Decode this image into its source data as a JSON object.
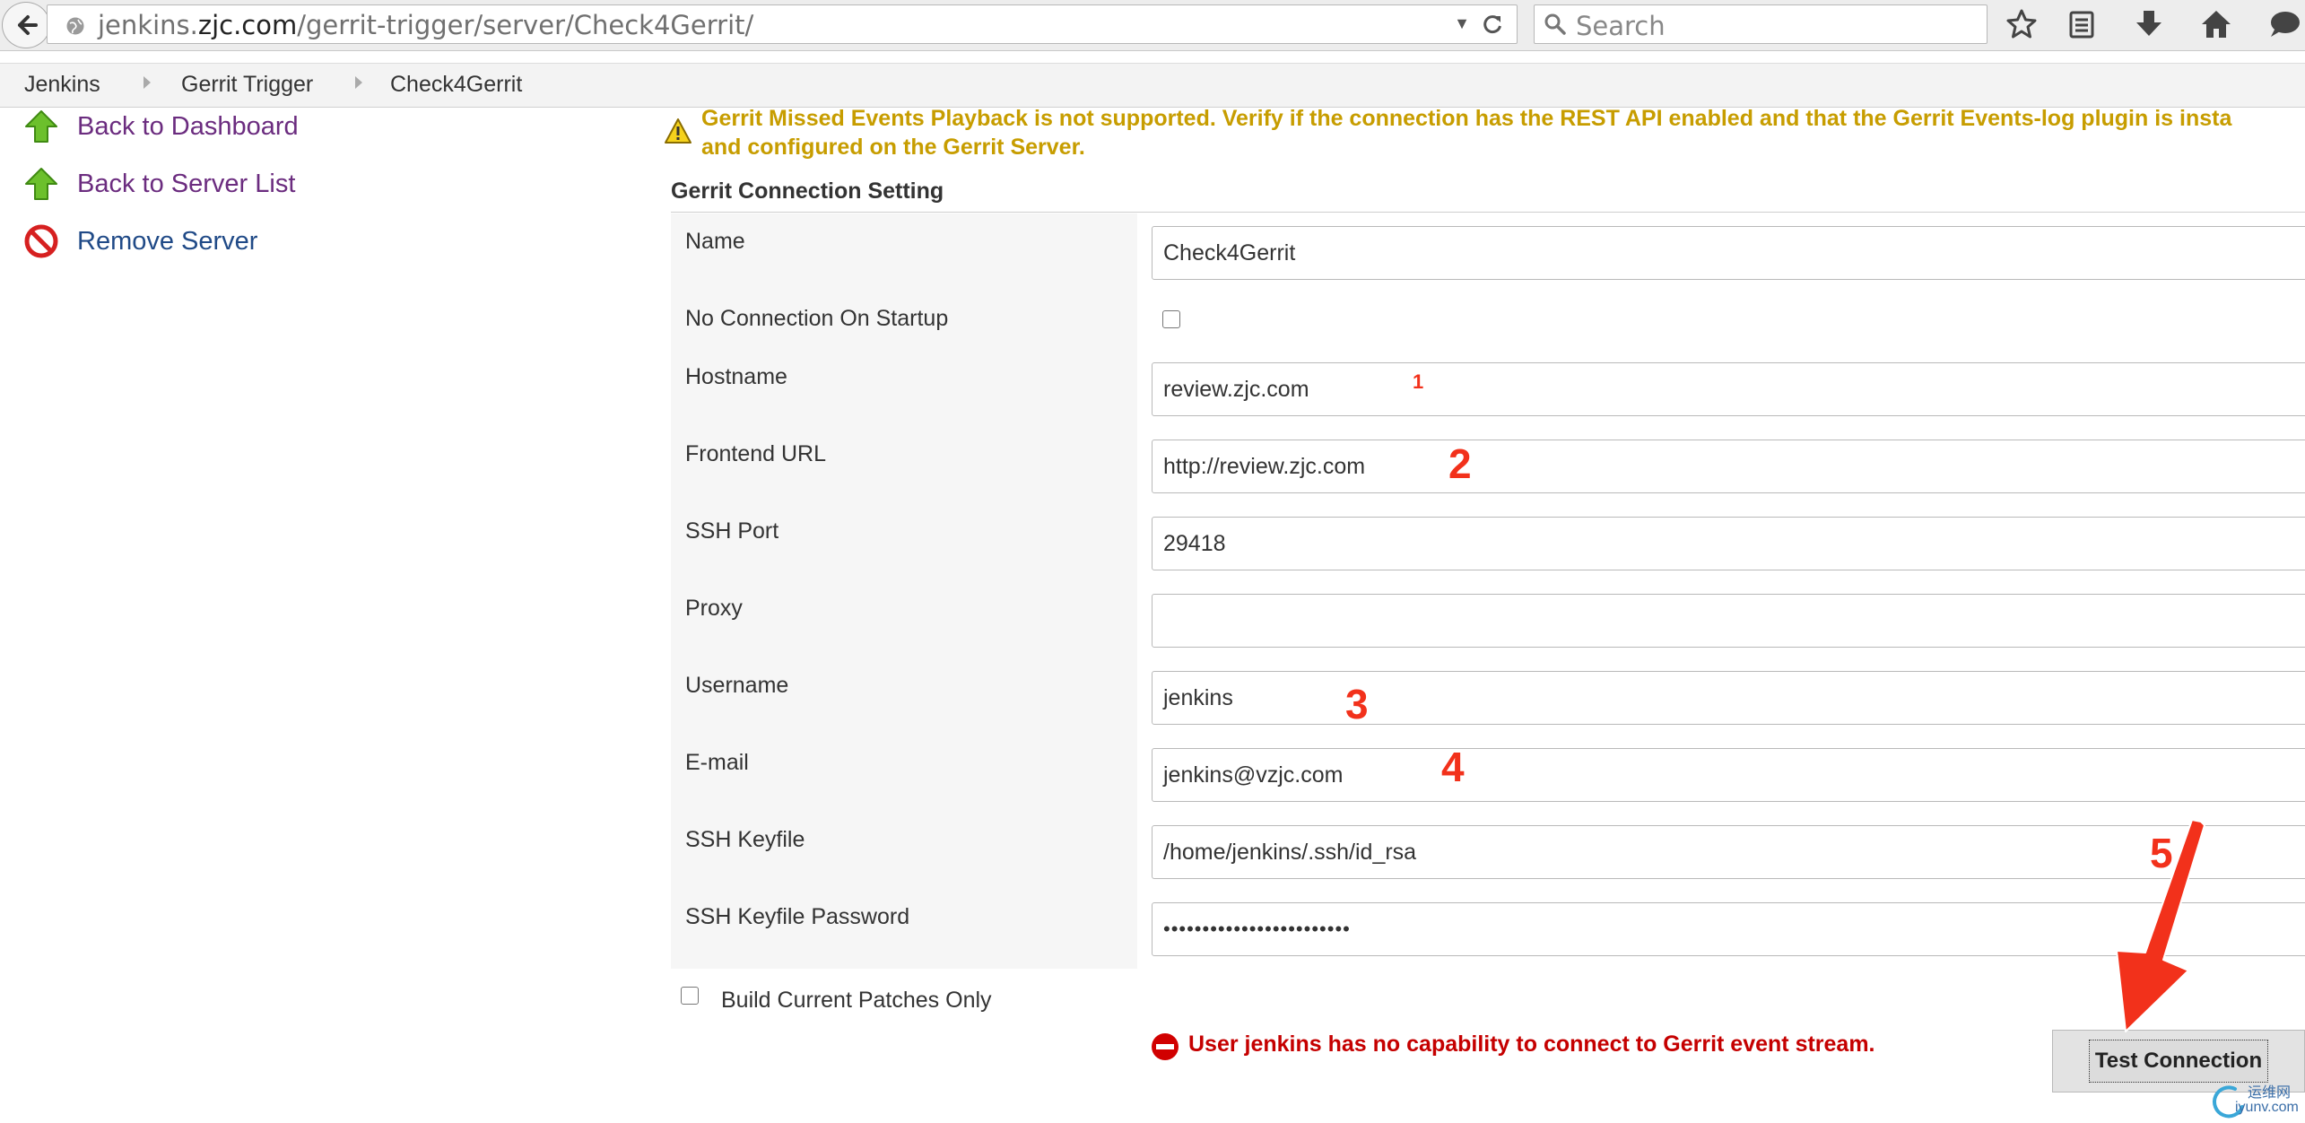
{
  "browser": {
    "url_domain_prefix": "jenkins.",
    "url_domain": "zjc.com",
    "url_path": "/gerrit-trigger/server/Check4Gerrit/",
    "search_placeholder": "Search"
  },
  "breadcrumb": [
    "Jenkins",
    "Gerrit Trigger",
    "Check4Gerrit"
  ],
  "sidebar": {
    "items": [
      {
        "label": "Back to Dashboard",
        "icon": "up-arrow-icon"
      },
      {
        "label": "Back to Server List",
        "icon": "up-arrow-icon"
      },
      {
        "label": "Remove Server",
        "icon": "no-entry-icon"
      }
    ]
  },
  "warning": {
    "line1": "Gerrit Missed Events Playback is not supported. Verify if the connection has the REST API enabled and that the Gerrit Events-log plugin is insta",
    "line2": "and configured on the Gerrit Server."
  },
  "section_title": "Gerrit Connection Setting",
  "form": {
    "name": {
      "label": "Name",
      "value": "Check4Gerrit"
    },
    "no_connection": {
      "label": "No Connection On Startup",
      "checked": false
    },
    "hostname": {
      "label": "Hostname",
      "value": "review.zjc.com"
    },
    "frontend_url": {
      "label": "Frontend URL",
      "value": "http://review.zjc.com"
    },
    "ssh_port": {
      "label": "SSH Port",
      "value": "29418"
    },
    "proxy": {
      "label": "Proxy",
      "value": ""
    },
    "username": {
      "label": "Username",
      "value": "jenkins"
    },
    "email": {
      "label": "E-mail",
      "value": "jenkins@vzjc.com"
    },
    "ssh_keyfile": {
      "label": "SSH Keyfile",
      "value": "/home/jenkins/.ssh/id_rsa"
    },
    "ssh_keyfile_password": {
      "label": "SSH Keyfile Password",
      "value": "••••••••••••••••••••••••"
    },
    "build_current_patches": {
      "label": "Build Current Patches Only",
      "checked": false
    }
  },
  "error_message": "User jenkins has no capability to connect to Gerrit event stream.",
  "test_connection_label": "Test Connection",
  "annotations": [
    "1",
    "2",
    "3",
    "4",
    "5"
  ],
  "watermark": {
    "line1": "运维网",
    "line2": "iyunv.com"
  },
  "colors": {
    "link_visited": "#6b2c7f",
    "link": "#204a87",
    "warning": "#c79d00",
    "error": "#c50000",
    "annotation": "#f2311b"
  }
}
